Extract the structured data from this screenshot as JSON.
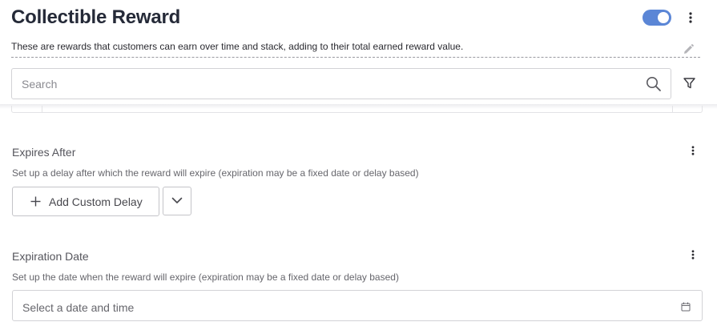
{
  "header": {
    "title": "Collectible Reward",
    "description": "These are rewards that customers can earn over time and stack, adding to their total earned reward value.",
    "enabled": true
  },
  "search": {
    "placeholder": "Search"
  },
  "sections": {
    "expires_after": {
      "title": "Expires After",
      "help": "Set up a delay after which the reward will expire (expiration may be a fixed date or delay based)",
      "add_label": "Add Custom Delay"
    },
    "expiration_date": {
      "title": "Expiration Date",
      "help": "Set up the date when the reward will expire (expiration may be a fixed date or delay based)",
      "placeholder": "Select a date and time"
    }
  },
  "icons": {
    "kebab": "more-vertical-icon",
    "edit": "pencil-icon",
    "search": "search-icon",
    "filter": "filter-icon",
    "plus": "plus-icon",
    "chevron": "chevron-down-icon",
    "calendar": "calendar-icon"
  },
  "colors": {
    "toggle_on": "#5b86d6",
    "title": "#252a38"
  }
}
